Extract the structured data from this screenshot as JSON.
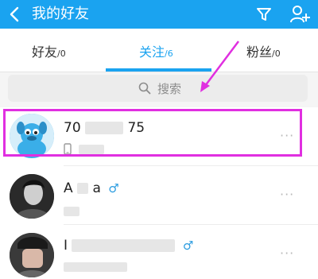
{
  "header": {
    "title": "我的好友"
  },
  "tabs": [
    {
      "label": "好友",
      "count": "/0"
    },
    {
      "label": "关注",
      "count": "/6"
    },
    {
      "label": "粉丝",
      "count": "/0"
    }
  ],
  "search": {
    "placeholder": "搜索"
  },
  "contacts": [
    {
      "name_start": "70",
      "name_end": "75"
    },
    {
      "name_start": "A",
      "name_end": "a",
      "gender": "♂"
    },
    {
      "name_start": "I",
      "gender": "♂"
    }
  ],
  "more_label": "···",
  "colors": {
    "accent": "#1aa3f0",
    "highlight": "#e02fe0",
    "gender": "#2d9de0"
  }
}
